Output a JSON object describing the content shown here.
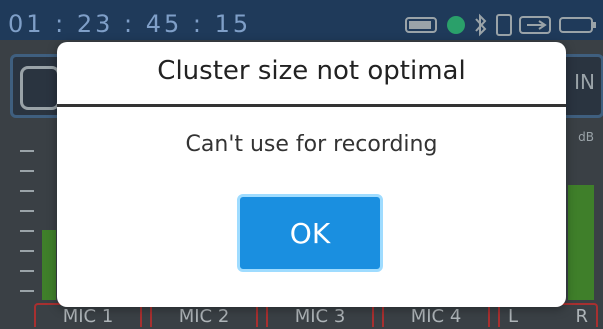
{
  "topbar": {
    "timecode": "01 : 23 : 45 : 15",
    "status_icons": [
      "battery-icon",
      "recording-dot-icon",
      "bluetooth-icon",
      "card-icon",
      "usb-icon",
      "battery-icon"
    ]
  },
  "meters": {
    "db_label": "dB",
    "panel_right_text": "IN",
    "channels": [
      "MIC 1",
      "MIC 2",
      "MIC 3",
      "MIC 4"
    ],
    "lr_left": "L",
    "lr_right": "R"
  },
  "dialog": {
    "title": "Cluster size not optimal",
    "message": "Can't use for recording",
    "ok_label": "OK"
  },
  "colors": {
    "dialog_bg": "#ffffff",
    "ok_button": "#1a8fe0",
    "ok_border": "#9fdcff",
    "topbar": "#1f3a5a"
  }
}
